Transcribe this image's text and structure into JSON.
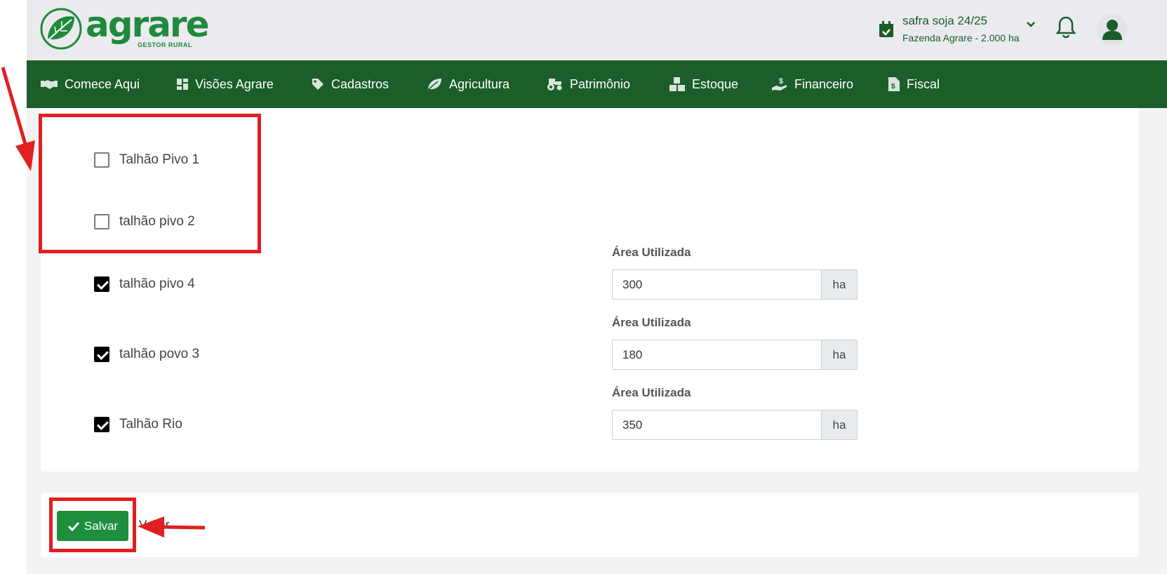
{
  "header": {
    "logo_text": "agrare",
    "logo_subtitle": "GESTOR RURAL",
    "season_title": "safra soja 24/25",
    "season_subtitle": "Fazenda Agrare - 2.000 ha"
  },
  "nav": {
    "items": [
      {
        "label": "Comece Aqui",
        "icon": "handshake-icon"
      },
      {
        "label": "Visões Agrare",
        "icon": "dashboard-icon"
      },
      {
        "label": "Cadastros",
        "icon": "tag-icon"
      },
      {
        "label": "Agricultura",
        "icon": "leaf-icon"
      },
      {
        "label": "Patrimônio",
        "icon": "tractor-icon"
      },
      {
        "label": "Estoque",
        "icon": "boxes-icon"
      },
      {
        "label": "Financeiro",
        "icon": "money-hand-icon"
      },
      {
        "label": "Fiscal",
        "icon": "invoice-icon"
      }
    ]
  },
  "fields": [
    {
      "label": "Talhão Pivo 1",
      "checked": false
    },
    {
      "label": "talhão pivo 2",
      "checked": false
    },
    {
      "label": "talhão pivo 4",
      "checked": true,
      "area_label": "Área Utilizada",
      "area_value": "300",
      "unit": "ha"
    },
    {
      "label": "talhão povo 3",
      "checked": true,
      "area_label": "Área Utilizada",
      "area_value": "180",
      "unit": "ha"
    },
    {
      "label": "Talhão Rio",
      "checked": true,
      "area_label": "Área Utilizada",
      "area_value": "350",
      "unit": "ha"
    }
  ],
  "actions": {
    "save_label": "Salvar",
    "back_label": "Voltar"
  },
  "colors": {
    "brand_green": "#1f8a3c",
    "nav_green": "#1b5e2a",
    "save_green": "#1e8f3d",
    "annotation_red": "#e02020"
  }
}
